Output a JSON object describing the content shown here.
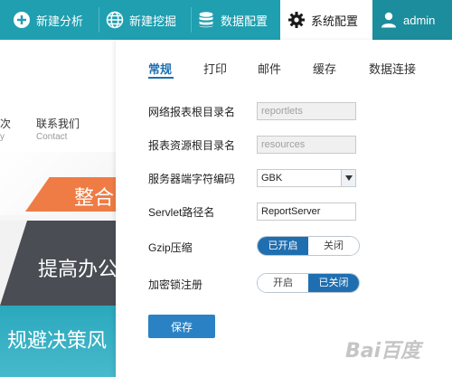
{
  "toolbar": {
    "new_analysis": "新建分析",
    "new_mining": "新建挖掘",
    "data_config": "数据配置",
    "system_config": "系统配置",
    "admin": "admin"
  },
  "background_site": {
    "nav_partial": "次",
    "nav_partial_sub": "y",
    "contact": "联系我们",
    "contact_sub": "Contact",
    "banner_orange": "整合",
    "banner_dark": "提高办公",
    "banner_teal": "规避决策风"
  },
  "tabs": [
    "常规",
    "打印",
    "邮件",
    "缓存",
    "数据连接"
  ],
  "form": {
    "report_root_label": "网络报表根目录名",
    "report_root_value": "reportlets",
    "resource_root_label": "报表资源根目录名",
    "resource_root_value": "resources",
    "encoding_label": "服务器端字符编码",
    "encoding_value": "GBK",
    "servlet_label": "Servlet路径名",
    "servlet_value": "ReportServer",
    "gzip_label": "Gzip压缩",
    "gzip_on": "已开启",
    "gzip_off": "关闭",
    "lock_label": "加密锁注册",
    "lock_on": "开启",
    "lock_off": "已关闭"
  },
  "save_label": "保存",
  "watermark": "Bai百度",
  "icons": {
    "toolbar_new_analysis": "plus-circle-icon",
    "toolbar_new_mining": "globe-icon",
    "toolbar_data_config": "database-icon",
    "toolbar_system_config": "gear-icon",
    "toolbar_admin": "user-icon",
    "encoding_dropdown": "chevron-down-icon"
  },
  "colors": {
    "toolbar_bg": "#1f9fb0",
    "active_tab": "#1f6fb0",
    "primary_button": "#2a82c4"
  }
}
